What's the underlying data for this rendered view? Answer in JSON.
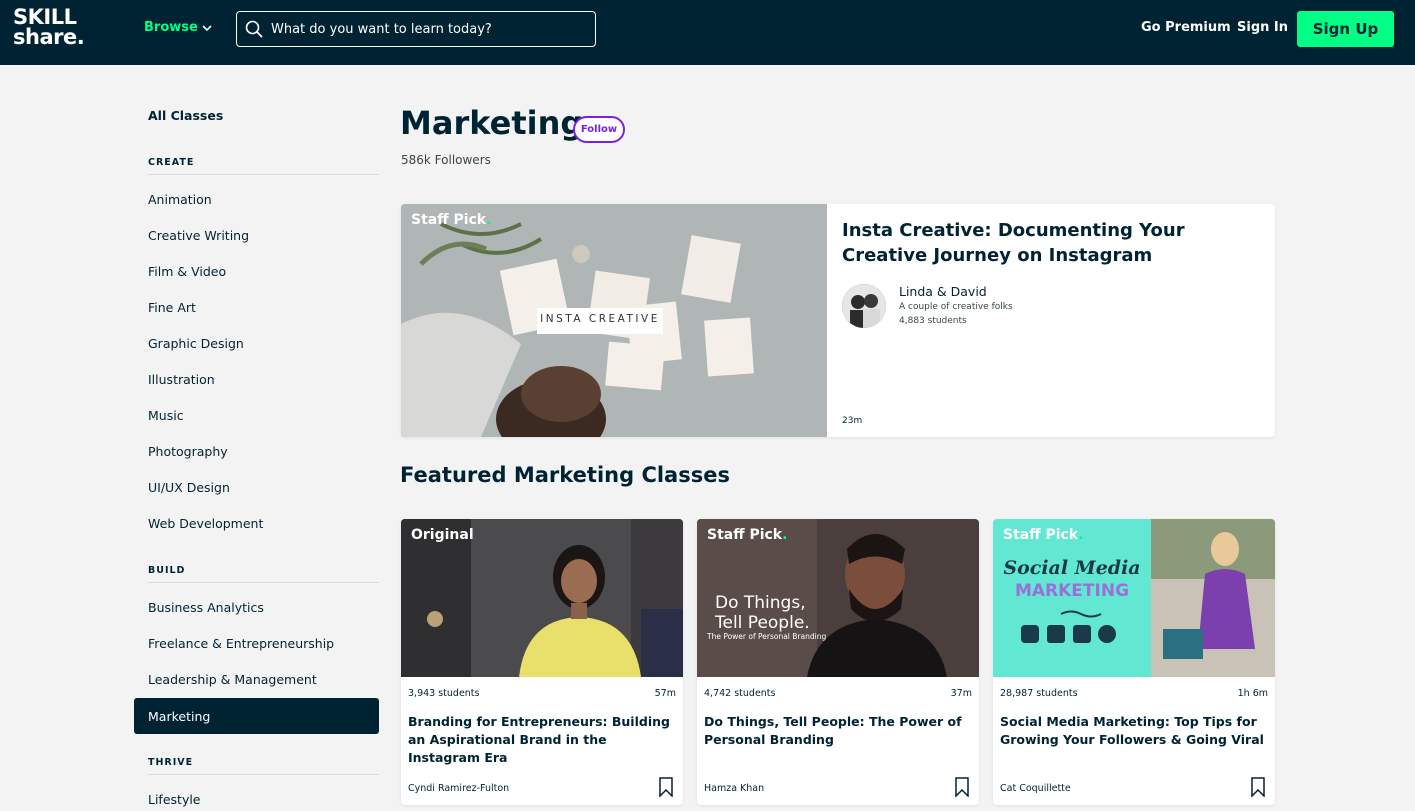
{
  "header": {
    "logo_line1": "SKILL",
    "logo_line2": "share.",
    "browse_label": "Browse",
    "search_placeholder": "What do you want to learn today?",
    "go_premium": "Go Premium",
    "sign_in": "Sign In",
    "sign_up": "Sign Up"
  },
  "sidebar": {
    "all_classes": "All Classes",
    "create_heading": "CREATE",
    "create_items": [
      "Animation",
      "Creative Writing",
      "Film & Video",
      "Fine Art",
      "Graphic Design",
      "Illustration",
      "Music",
      "Photography",
      "UI/UX Design",
      "Web Development"
    ],
    "build_heading": "BUILD",
    "build_items": [
      "Business Analytics",
      "Freelance & Entrepreneurship",
      "Leadership & Management",
      "Marketing"
    ],
    "thrive_heading": "THRIVE",
    "thrive_items": [
      "Lifestyle"
    ],
    "active_item": "Marketing"
  },
  "main": {
    "title": "Marketing",
    "follow_label": "Follow",
    "followers": "586k Followers",
    "featured_heading": "Featured Marketing Classes"
  },
  "hero": {
    "badge": "Staff Pick",
    "image_text": "INSTA CREATIVE",
    "title": "Insta Creative: Documenting Your Creative Journey on Instagram",
    "teacher": "Linda & David",
    "teacher_sub": "A couple of creative folks",
    "students": "4,883 students",
    "duration": "23m"
  },
  "cards": [
    {
      "badge": "Original",
      "students": "3,943 students",
      "duration": "57m",
      "title": "Branding for Entrepreneurs: Building an Aspirational Brand in the Instagram Era",
      "author": "Cyndi Ramirez-Fulton"
    },
    {
      "badge": "Staff Pick",
      "img_line1": "Do Things,",
      "img_line2": "Tell People.",
      "img_line3": "The Power of Personal Branding",
      "students": "4,742 students",
      "duration": "37m",
      "title": "Do Things, Tell People: The Power of Personal Branding",
      "author": "Hamza Khan"
    },
    {
      "badge": "Staff Pick",
      "img_line1": "Social Media",
      "img_line2": "MARKETING",
      "students": "28,987 students",
      "duration": "1h 6m",
      "title": "Social Media Marketing: Top Tips for Growing Your Followers & Going Viral",
      "author": "Cat Coquillette"
    }
  ],
  "colors": {
    "navy": "#002333",
    "green": "#00ff84",
    "purple": "#7b1fe4"
  }
}
